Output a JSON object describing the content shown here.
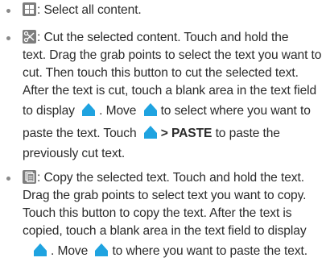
{
  "items": [
    {
      "icon": "select-all-icon",
      "lines": [
        ": Select all content."
      ]
    },
    {
      "icon": "cut-icon",
      "lines": [
        ": Cut the selected content. Touch and hold the",
        "text. Drag the grab points to select the text you want to",
        "cut. Then touch this button to cut the selected text.",
        "After the text is cut, touch a blank area in the text field"
      ],
      "line5_a": "to display",
      "line5_b": ". Move",
      "line5_c": "to select where you want to",
      "line6_a": "paste the text. Touch",
      "line6_bold": "> PASTE",
      "line6_c": "to paste the",
      "line7": "previously cut text."
    },
    {
      "icon": "copy-icon",
      "lines": [
        ": Copy the selected text. Touch and hold the text.",
        "Drag the grab points to select text you want to copy.",
        "Touch this button to copy the text. After the text is",
        "copied, touch a blank area in the text field to display"
      ],
      "line5_a": ". Move",
      "line5_b": "to where you want to paste the text."
    }
  ],
  "colors": {
    "handle": "#1fa3e0",
    "icon_bg": "#7d7d7d",
    "text": "#2b2b2b"
  }
}
